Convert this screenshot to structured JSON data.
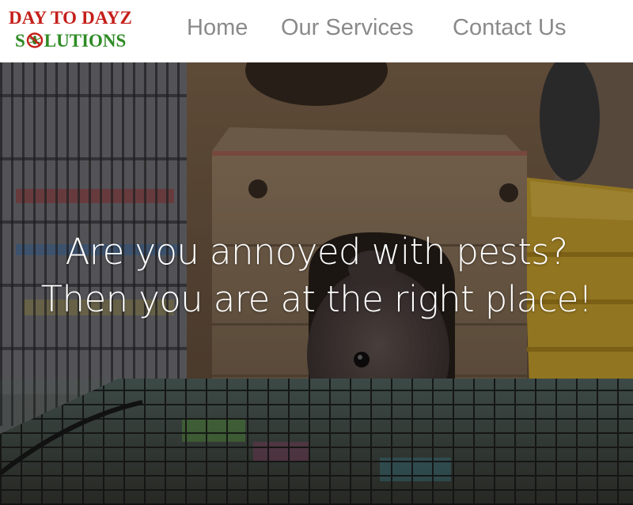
{
  "brand": {
    "line1": "DAY TO DAYZ",
    "line2_prefix": "S",
    "line2_suffix": "LUTIONS",
    "mark_icon": "no-pest-icon",
    "colors": {
      "red": "#c51f1a",
      "green": "#2e8b24"
    }
  },
  "nav": {
    "items": [
      {
        "label": "Home"
      },
      {
        "label": "Our Services"
      },
      {
        "label": "Contact Us"
      }
    ],
    "color": "#8a8a8a"
  },
  "hero": {
    "line1": "Are you annoyed with pests?",
    "line2": "Then you are at the right place!",
    "image": "rat-in-wooden-house-photo"
  }
}
